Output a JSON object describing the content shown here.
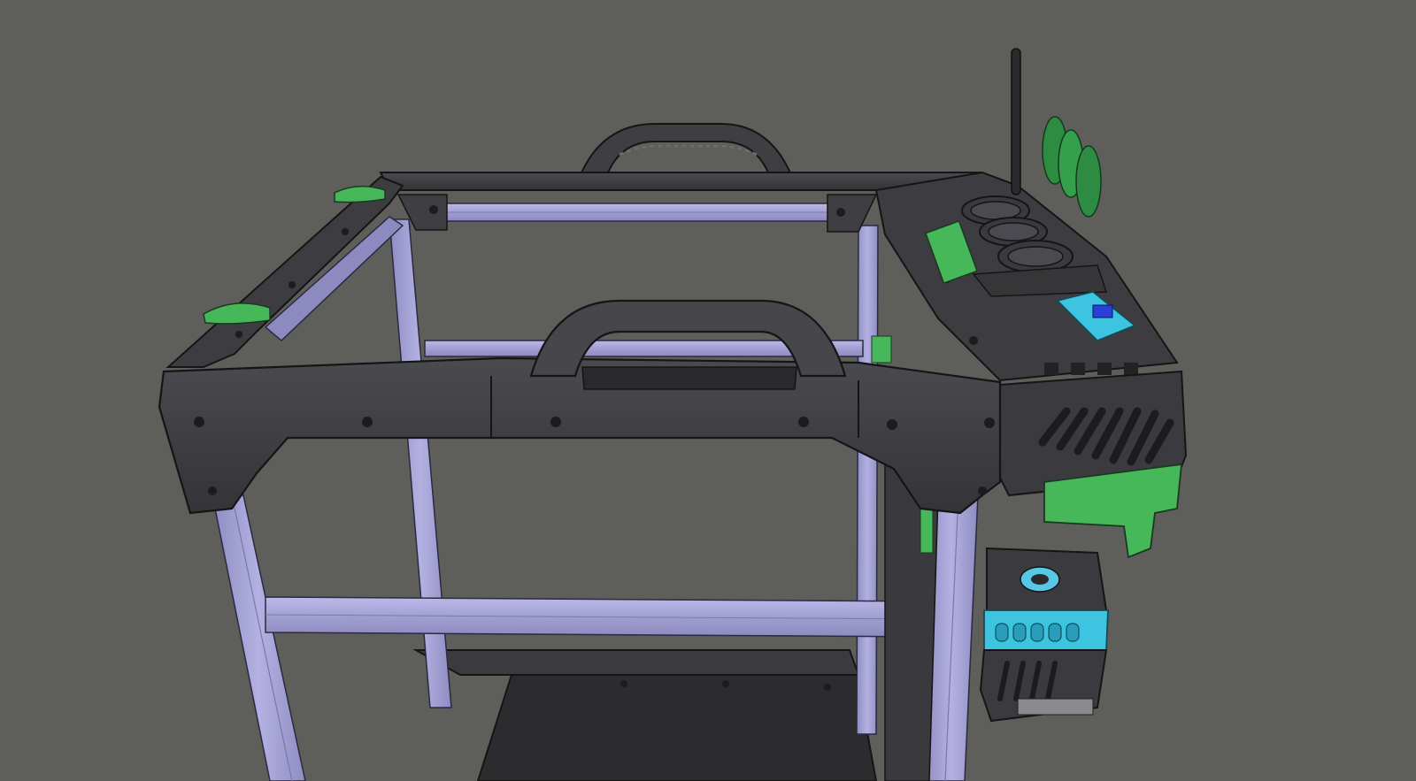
{
  "scene": {
    "background_color": "#5e5e5b",
    "subject": "3d-printer-frame-cad-model",
    "part_colors": {
      "frame_extrusion": "#a7a4d6",
      "printed_part_dark": "#3b3b3f",
      "printed_part_green": "#46b85a",
      "printed_part_cyan": "#3cc4e0",
      "bed_plate": "#2c2c2e",
      "edge_line": "#1a1a1c"
    },
    "components": [
      "rear-handle",
      "front-handle",
      "top-frame-corners",
      "aluminium-extrusions",
      "spool-holder-cups",
      "filament-guides",
      "antenna",
      "cyan-bracket",
      "motor-mount",
      "print-bed"
    ]
  }
}
